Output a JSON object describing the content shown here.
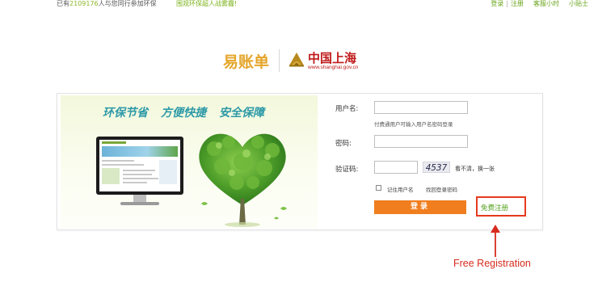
{
  "topbar": {
    "left_prefix": "已有",
    "user_count": "2109176",
    "left_suffix": "人与您同行参加环保",
    "slogan": "围观环保超人战雾霾!",
    "links": [
      "登录",
      "注册",
      "客服小时",
      "小贴士"
    ]
  },
  "brand": {
    "app_name": "易账单",
    "partner_title": "中国上海",
    "partner_url": "www.shanghai.gov.cn"
  },
  "banner": {
    "slogans": [
      "环保节省",
      "方便快捷",
      "安全保障"
    ]
  },
  "form": {
    "username_label": "用户名:",
    "username_value": "",
    "username_hint": "付费通用户可输入用户名密码登录",
    "password_label": "密码:",
    "password_value": "",
    "captcha_label": "验证码:",
    "captcha_value": "",
    "captcha_image_text": "4537",
    "captcha_refresh": "看不清，换一张",
    "remember_label": "记住用户名",
    "remember_checked": false,
    "forgot_link": "找回登录密码",
    "login_button": "登录",
    "register_link": "免费注册"
  },
  "annotation": {
    "text": "Free Registration",
    "color": "#d62b1e"
  },
  "colors": {
    "accent_green": "#6aa41a",
    "login_orange": "#f07e1e",
    "brand_red": "#c01a1a",
    "highlight_red": "#e53a1e"
  }
}
